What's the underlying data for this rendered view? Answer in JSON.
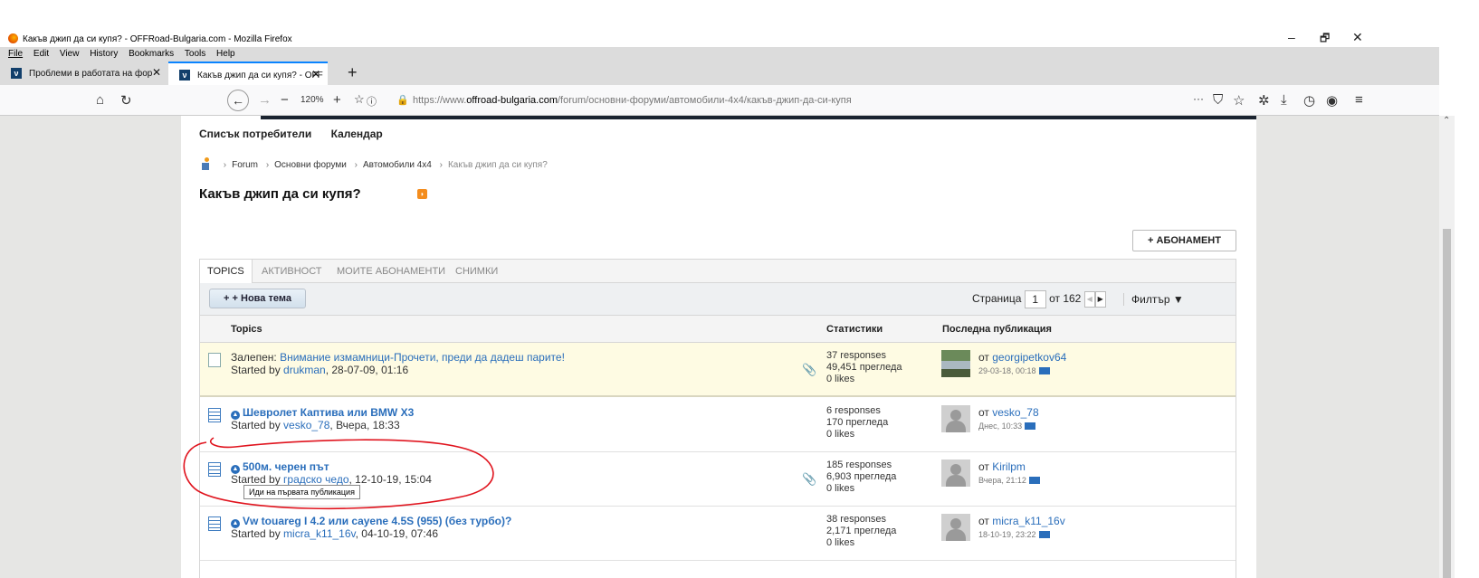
{
  "window": {
    "title": "Какъв джип да си купя? - OFFRoad-Bulgaria.com - Mozilla Firefox",
    "minimize_glyph": "–",
    "restore_glyph": "🗗",
    "close_glyph": "✕"
  },
  "menu": [
    "File",
    "Edit",
    "View",
    "History",
    "Bookmarks",
    "Tools",
    "Help"
  ],
  "tabs": [
    {
      "label": "Проблеми в работата на фор",
      "close": "✕"
    },
    {
      "label": "Какъв джип да си купя? - OFF",
      "close": "✕"
    }
  ],
  "newtab_glyph": "+",
  "nav": {
    "zoom": "120%",
    "url_prefix": "https://www.",
    "url_domain": "offroad-bulgaria.com",
    "url_path": "/forum/основни-форуми/автомобили-4x4/какъв-джип-да-си-купя"
  },
  "site": {
    "topnav": [
      "Списък потребители",
      "Календар"
    ],
    "breadcrumbs": [
      "Forum",
      "Основни форуми",
      "Автомобили 4x4",
      "Какъв джип да си купя?"
    ],
    "page_title": "Какъв джип да си купя?",
    "subscribe": "+ АБОНАМЕНТ",
    "forum_tabs": [
      "TOPICS",
      "АКТИВНОСТ",
      "МОИТЕ АБОНАМЕНТИ",
      "СНИМКИ"
    ],
    "new_topic": "+ + Нова тема",
    "pager": {
      "label": "Страница",
      "current": "1",
      "of": "от 162",
      "prev": "◀",
      "next": "▶"
    },
    "filter": "Филтър ▼",
    "columns": {
      "topics": "Topics",
      "stats": "Статистики",
      "last": "Последна публикация"
    },
    "topics": [
      {
        "prefix": "Залепен: ",
        "title": "Внимание измамници-Прочети, преди да дадеш парите!",
        "started_by": "Started by ",
        "author": "drukman",
        "date": ", 28-07-09, 01:16",
        "responses": "37 responses",
        "views": "49,451 прегледа",
        "likes": "0 likes",
        "last_from": "от ",
        "last_user": "georgipetkov64",
        "last_date": "29-03-18, 00:18"
      },
      {
        "prefix": "",
        "title": "Шевролет Каптива или BMW X3",
        "started_by": "Started by ",
        "author": "vesko_78",
        "date": ", Вчера, 18:33",
        "responses": "6 responses",
        "views": "170 прегледа",
        "likes": "0 likes",
        "last_from": "от ",
        "last_user": "vesko_78",
        "last_date": "Днес, 10:33"
      },
      {
        "prefix": "",
        "title": "500м. черен път",
        "started_by": "Started by ",
        "author": "градско чедо",
        "date": ", 12-10-19, 15:04",
        "responses": "185 responses",
        "views": "6,903 прегледа",
        "likes": "0 likes",
        "last_from": "от ",
        "last_user": "Kirilpm",
        "last_date": "Вчера, 21:12"
      },
      {
        "prefix": "",
        "title": "Vw touareg I 4.2 или cayene 4.5S (955) (без турбо)?",
        "started_by": "Started by ",
        "author": "micra_k11_16v",
        "date": ", 04-10-19, 07:46",
        "responses": "38 responses",
        "views": "2,171 прегледа",
        "likes": "0 likes",
        "last_from": "от ",
        "last_user": "micra_k11_16v",
        "last_date": "18-10-19, 23:22"
      }
    ],
    "tooltip": "Иди на първата публикация"
  },
  "colors": {
    "link": "#2a6ebb",
    "annotation": "#e0141e",
    "sticky_bg": "#fefbe3"
  }
}
